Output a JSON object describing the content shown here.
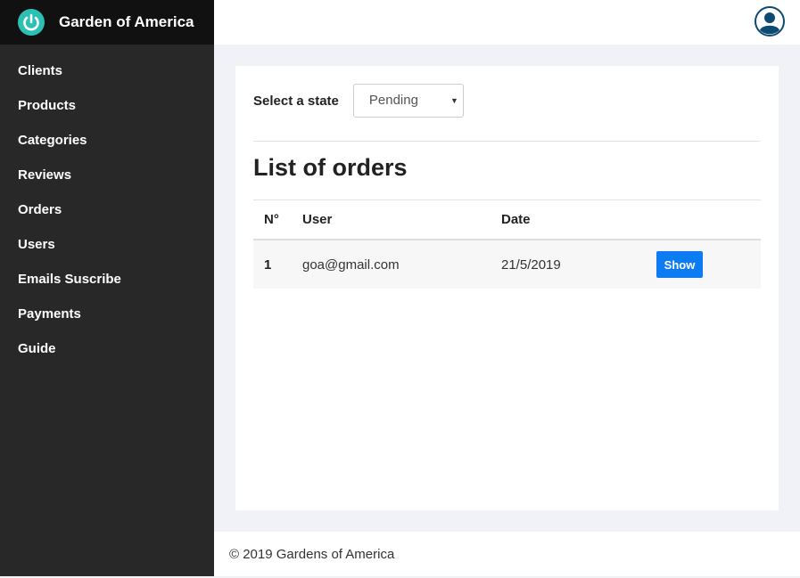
{
  "brand": {
    "name": "Garden of America",
    "logo_icon": "power-icon",
    "logo_color": "#2cc0b5"
  },
  "sidebar": {
    "items": [
      {
        "label": "Clients"
      },
      {
        "label": "Products"
      },
      {
        "label": "Categories"
      },
      {
        "label": "Reviews"
      },
      {
        "label": "Orders"
      },
      {
        "label": "Users"
      },
      {
        "label": "Emails Suscribe"
      },
      {
        "label": "Payments"
      },
      {
        "label": "Guide"
      }
    ]
  },
  "topbar": {
    "avatar_icon": "user-avatar-icon"
  },
  "filter": {
    "label": "Select a state",
    "selected": "Pending"
  },
  "main": {
    "title": "List of orders",
    "table": {
      "headers": [
        "N°",
        "User",
        "Date",
        ""
      ],
      "rows": [
        {
          "num": "1",
          "user": "goa@gmail.com",
          "date": "21/5/2019",
          "action": "Show"
        }
      ]
    }
  },
  "footer": {
    "text": "© 2019 Gardens of America"
  },
  "colors": {
    "sidebar_bg": "#282828",
    "brand_bg": "#111111",
    "button_blue": "#0d7cf2",
    "page_bg": "#f1f2f7"
  }
}
